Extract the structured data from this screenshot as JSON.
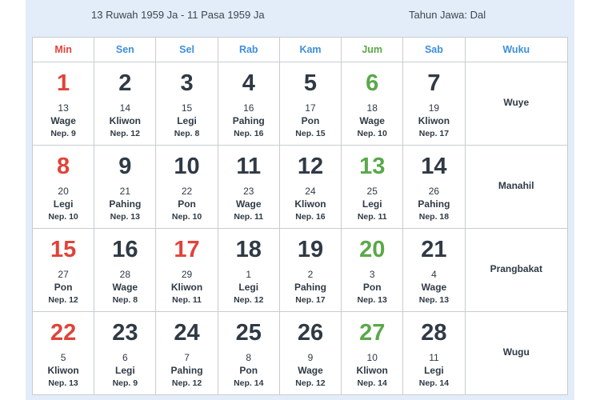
{
  "header": {
    "date_range": "13 Ruwah 1959 Ja - 11 Pasa 1959 Ja",
    "tahun": "Tahun Jawa: Dal"
  },
  "columns": [
    "Min",
    "Sen",
    "Sel",
    "Rab",
    "Kam",
    "Jum",
    "Sab",
    "Wuku"
  ],
  "colors": {
    "sunday_holiday": "#e0433a",
    "weekday_header": "#3f8fdb",
    "friday": "#5aa84a",
    "text": "#2f3a45"
  },
  "weeks": [
    {
      "wuku": "Wuye",
      "days": [
        {
          "num": "1",
          "jv": "13",
          "pasaran": "Wage",
          "nep": "Nep. 9",
          "color": "red"
        },
        {
          "num": "2",
          "jv": "14",
          "pasaran": "Kliwon",
          "nep": "Nep. 12",
          "color": "dark"
        },
        {
          "num": "3",
          "jv": "15",
          "pasaran": "Legi",
          "nep": "Nep. 8",
          "color": "dark"
        },
        {
          "num": "4",
          "jv": "16",
          "pasaran": "Pahing",
          "nep": "Nep. 16",
          "color": "dark"
        },
        {
          "num": "5",
          "jv": "17",
          "pasaran": "Pon",
          "nep": "Nep. 15",
          "color": "dark"
        },
        {
          "num": "6",
          "jv": "18",
          "pasaran": "Wage",
          "nep": "Nep. 10",
          "color": "green"
        },
        {
          "num": "7",
          "jv": "19",
          "pasaran": "Kliwon",
          "nep": "Nep. 17",
          "color": "dark"
        }
      ]
    },
    {
      "wuku": "Manahil",
      "days": [
        {
          "num": "8",
          "jv": "20",
          "pasaran": "Legi",
          "nep": "Nep. 10",
          "color": "red"
        },
        {
          "num": "9",
          "jv": "21",
          "pasaran": "Pahing",
          "nep": "Nep. 13",
          "color": "dark"
        },
        {
          "num": "10",
          "jv": "22",
          "pasaran": "Pon",
          "nep": "Nep. 10",
          "color": "dark"
        },
        {
          "num": "11",
          "jv": "23",
          "pasaran": "Wage",
          "nep": "Nep. 11",
          "color": "dark"
        },
        {
          "num": "12",
          "jv": "24",
          "pasaran": "Kliwon",
          "nep": "Nep. 16",
          "color": "dark"
        },
        {
          "num": "13",
          "jv": "25",
          "pasaran": "Legi",
          "nep": "Nep. 11",
          "color": "green"
        },
        {
          "num": "14",
          "jv": "26",
          "pasaran": "Pahing",
          "nep": "Nep. 18",
          "color": "dark"
        }
      ]
    },
    {
      "wuku": "Prangbakat",
      "days": [
        {
          "num": "15",
          "jv": "27",
          "pasaran": "Pon",
          "nep": "Nep. 12",
          "color": "red"
        },
        {
          "num": "16",
          "jv": "28",
          "pasaran": "Wage",
          "nep": "Nep. 8",
          "color": "dark"
        },
        {
          "num": "17",
          "jv": "29",
          "pasaran": "Kliwon",
          "nep": "Nep. 11",
          "color": "red"
        },
        {
          "num": "18",
          "jv": "1",
          "pasaran": "Legi",
          "nep": "Nep. 12",
          "color": "dark"
        },
        {
          "num": "19",
          "jv": "2",
          "pasaran": "Pahing",
          "nep": "Nep. 17",
          "color": "dark"
        },
        {
          "num": "20",
          "jv": "3",
          "pasaran": "Pon",
          "nep": "Nep. 13",
          "color": "green"
        },
        {
          "num": "21",
          "jv": "4",
          "pasaran": "Wage",
          "nep": "Nep. 13",
          "color": "dark"
        }
      ]
    },
    {
      "wuku": "Wugu",
      "days": [
        {
          "num": "22",
          "jv": "5",
          "pasaran": "Kliwon",
          "nep": "Nep. 13",
          "color": "red"
        },
        {
          "num": "23",
          "jv": "6",
          "pasaran": "Legi",
          "nep": "Nep. 9",
          "color": "dark"
        },
        {
          "num": "24",
          "jv": "7",
          "pasaran": "Pahing",
          "nep": "Nep. 12",
          "color": "dark"
        },
        {
          "num": "25",
          "jv": "8",
          "pasaran": "Pon",
          "nep": "Nep. 14",
          "color": "dark"
        },
        {
          "num": "26",
          "jv": "9",
          "pasaran": "Wage",
          "nep": "Nep. 12",
          "color": "dark"
        },
        {
          "num": "27",
          "jv": "10",
          "pasaran": "Kliwon",
          "nep": "Nep. 14",
          "color": "green"
        },
        {
          "num": "28",
          "jv": "11",
          "pasaran": "Legi",
          "nep": "Nep. 14",
          "color": "dark"
        }
      ]
    }
  ]
}
